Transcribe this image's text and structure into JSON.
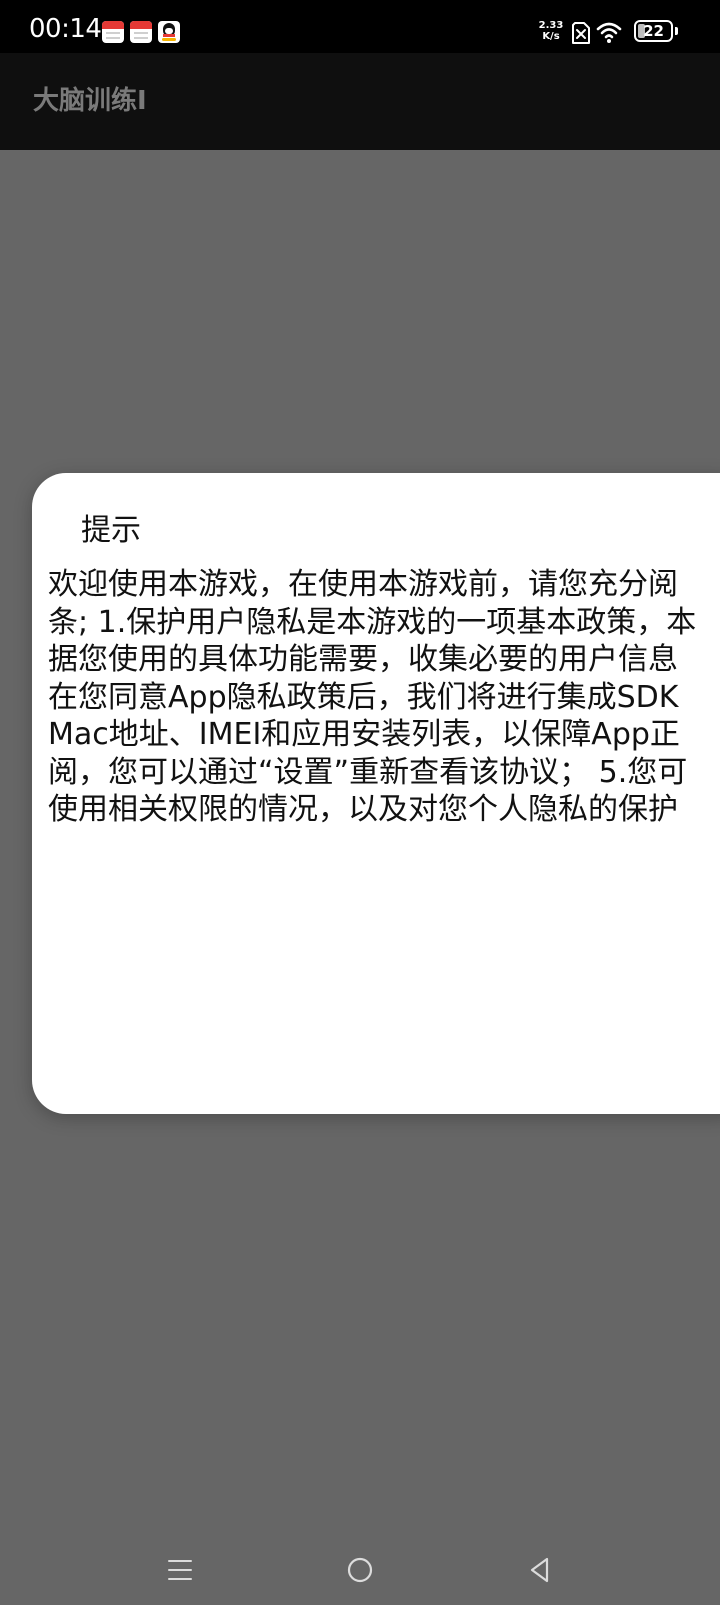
{
  "status_bar": {
    "time": "00:14",
    "notification_icons": [
      "calendar-icon",
      "calendar-icon",
      "qq-icon"
    ],
    "net_speed_value": "2.33",
    "net_speed_unit": "K/s",
    "sim_icon": "sim-disabled-icon",
    "wifi_icon": "wifi-icon",
    "battery_level": "22"
  },
  "app_bar": {
    "title": "大脑训练I"
  },
  "dialog": {
    "title": "提示",
    "message_lines": [
      "欢迎使用本游戏，在使用本游戏前，请您充分阅",
      "条; 1.保护用户隐私是本游戏的一项基本政策，本",
      "据您使用的具体功能需要，收集必要的用户信息",
      "在您同意App隐私政策后，我们将进行集成SDK",
      "Mac地址、IMEI和应用安装列表，以保障App正",
      "阅，您可以通过“设置”重新查看该协议； 5.您可",
      "使用相关权限的情况，以及对您个人隐私的保护"
    ]
  },
  "nav_bar": {
    "menu_icon": "menu-icon",
    "home_icon": "home-icon",
    "back_icon": "back-icon"
  },
  "colors": {
    "status_bar_bg": "#000000",
    "app_bar_bg": "#0f0f0f",
    "scrim_bg": "#666666",
    "dialog_bg": "#ffffff",
    "app_title_color": "#7a7a7a"
  }
}
